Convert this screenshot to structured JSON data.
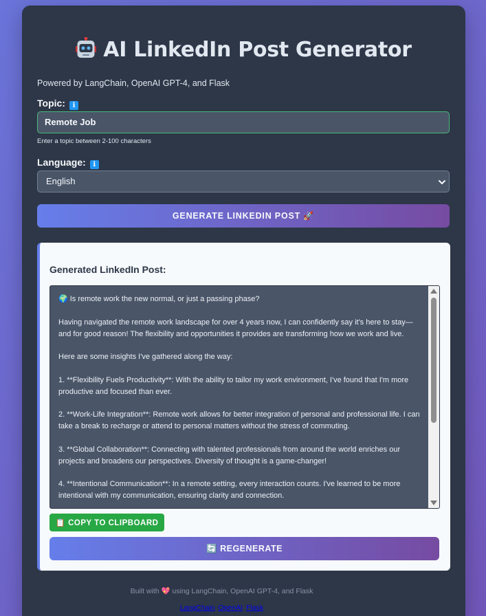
{
  "header": {
    "title": "AI LinkedIn Post Generator",
    "subtitle": "Powered by LangChain, OpenAI GPT-4, and Flask",
    "icon": "robot-icon"
  },
  "form": {
    "topic_label": "Topic:",
    "topic_value": "Remote Job",
    "topic_hint": "Enter a topic between 2-100 characters",
    "language_label": "Language:",
    "language_value": "English",
    "info_glyph": "i",
    "generate_label": "GENERATE LINKEDIN POST",
    "generate_icon": "rocket-icon"
  },
  "result": {
    "title": "Generated LinkedIn Post:",
    "paragraphs": [
      "🌍 Is remote work the new normal, or just a passing phase?",
      "Having navigated the remote work landscape for over 4 years now, I can confidently say it's here to stay—and for good reason! The flexibility and opportunities it provides are transforming how we work and live.",
      "Here are some insights I've gathered along the way:",
      "1. **Flexibility Fuels Productivity**: With the ability to tailor my work environment, I've found that I'm more productive and focused than ever.",
      "2. **Work-Life Integration**: Remote work allows for better integration of personal and professional life. I can take a break to recharge or attend to personal matters without the stress of commuting.",
      "3. **Global Collaboration**: Connecting with talented professionals from around the world enriches our projects and broadens our perspectives. Diversity of thought is a game-changer!",
      "4. **Intentional Communication**: In a remote setting, every interaction counts. I've learned to be more intentional with my communication, ensuring clarity and connection."
    ],
    "copy_label": "COPY TO CLIPBOARD",
    "copy_icon": "clipboard-icon",
    "regenerate_label": "REGENERATE",
    "regenerate_icon": "refresh-icon"
  },
  "footer": {
    "text_before": "Built with",
    "text_after": "using LangChain, OpenAI GPT-4, and Flask",
    "heart_icon": "heart-icon",
    "links": [
      "LangChain",
      "OpenAI",
      "Flask"
    ]
  },
  "colors": {
    "background_start": "#6a74d9",
    "background_end": "#7257ba",
    "card": "#2d3748",
    "input": "#4a5568",
    "valid_border": "#48bb78",
    "button_start": "#667eea",
    "button_end": "#764ba2",
    "copy_button": "#28a745",
    "info_badge": "#2196f3"
  }
}
